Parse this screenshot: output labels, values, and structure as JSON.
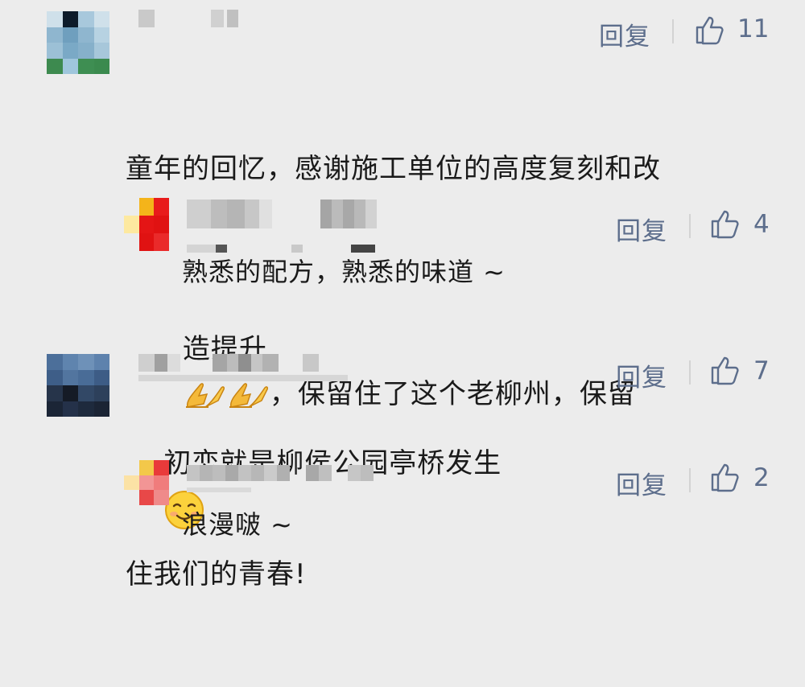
{
  "comments": [
    {
      "text_line1": "童年的回忆，感谢施工单位的高度复刻和改",
      "text_line2_a": "造提升",
      "text_line2_b": "，保留住了这个老柳州，保留",
      "text_line3": "住我们的青春!",
      "reply_label": "回复",
      "likes": "11",
      "emojis": [
        "folded-hands",
        "folded-hands"
      ],
      "replies": [
        {
          "text": "熟悉的配方，熟悉的味道 ~",
          "reply_label": "回复",
          "likes": "4"
        }
      ]
    },
    {
      "text_a": "初恋就是柳侯公园亭桥发生",
      "reply_label": "回复",
      "likes": "7",
      "emojis": [
        "smiling-face"
      ],
      "replies": [
        {
          "text": "浪漫啵 ~",
          "reply_label": "回复",
          "likes": "2"
        }
      ]
    }
  ],
  "colors": {
    "background": "#ececec",
    "action": "#5d6e8c",
    "text": "#1a1a1a"
  }
}
